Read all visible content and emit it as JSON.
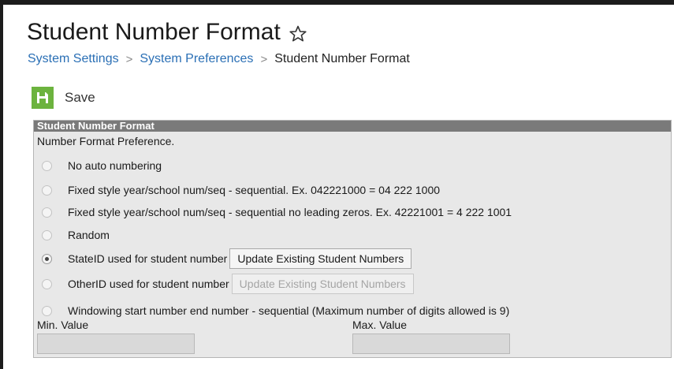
{
  "page": {
    "title": "Student Number Format",
    "star_icon": "star-outline-icon"
  },
  "breadcrumb": {
    "items": [
      "System Settings",
      "System Preferences",
      "Student Number Format"
    ],
    "separator": ">"
  },
  "toolbar": {
    "save_label": "Save",
    "save_icon": "floppy-disk-icon",
    "save_color": "#6cb33e"
  },
  "panel": {
    "header": "Student Number Format",
    "description": "Number Format Preference.",
    "options": [
      {
        "label": "No auto numbering",
        "checked": false
      },
      {
        "label": "Fixed style year/school num/seq - sequential. Ex. 042221000 = 04 222 1000",
        "checked": false
      },
      {
        "label": "Fixed style year/school num/seq - sequential no leading zeros. Ex. 42221001 = 4 222 1001",
        "checked": false
      },
      {
        "label": "Random",
        "checked": false
      },
      {
        "label": "StateID used for student number",
        "checked": true,
        "button": "Update Existing Student Numbers",
        "button_enabled": true
      },
      {
        "label": "OtherID used for student number",
        "checked": false,
        "button": "Update Existing Student Numbers",
        "button_enabled": false
      },
      {
        "label": "Windowing start number end number - sequential (Maximum number of digits allowed is 9)",
        "checked": false
      }
    ],
    "min_label": "Min. Value",
    "min_value": "",
    "max_label": "Max. Value",
    "max_value": ""
  }
}
